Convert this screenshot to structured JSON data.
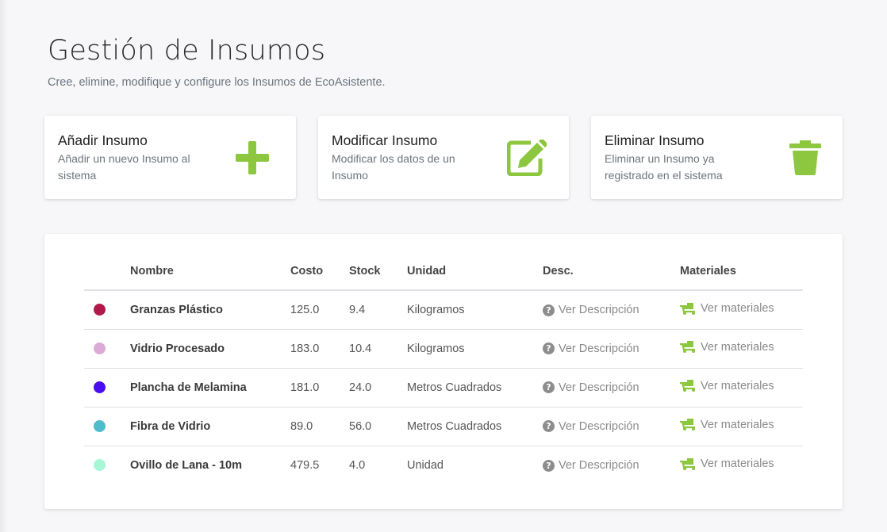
{
  "header": {
    "title": "Gestión de Insumos",
    "subtitle": "Cree, elimine, modifique y configure los Insumos de EcoAsistente."
  },
  "cards": [
    {
      "title": "Añadir Insumo",
      "description": "Añadir un nuevo Insumo al sistema",
      "icon": "plus-icon"
    },
    {
      "title": "Modificar Insumo",
      "description": "Modificar los datos de un Insumo",
      "icon": "edit-icon"
    },
    {
      "title": "Eliminar Insumo",
      "description": "Eliminar un Insumo ya registrado en el sistema",
      "icon": "trash-icon"
    }
  ],
  "accent_color": "#8dc63f",
  "table": {
    "columns": [
      "",
      "Nombre",
      "Costo",
      "Stock",
      "Unidad",
      "Desc.",
      "Materiales"
    ],
    "desc_link": "Ver Descripción",
    "materials_link": "Ver materiales",
    "rows": [
      {
        "color": "#b0194a",
        "name": "Granzas Plástico",
        "cost": "125.0",
        "stock": "9.4",
        "unit": "Kilogramos"
      },
      {
        "color": "#dcaad6",
        "name": "Vidrio Procesado",
        "cost": "183.0",
        "stock": "10.4",
        "unit": "Kilogramos"
      },
      {
        "color": "#4a0ef0",
        "name": "Plancha de Melamina",
        "cost": "181.0",
        "stock": "24.0",
        "unit": "Metros Cuadrados"
      },
      {
        "color": "#4ebccb",
        "name": "Fibra de Vidrio",
        "cost": "89.0",
        "stock": "56.0",
        "unit": "Metros Cuadrados"
      },
      {
        "color": "#a6f7d5",
        "name": "Ovillo de Lana - 10m",
        "cost": "479.5",
        "stock": "4.0",
        "unit": "Unidad"
      }
    ]
  }
}
